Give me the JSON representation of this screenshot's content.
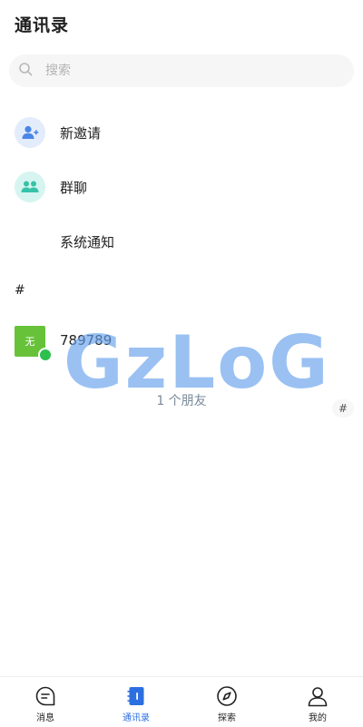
{
  "header": {
    "title": "通讯录"
  },
  "search": {
    "placeholder": "搜索"
  },
  "menu": {
    "new_invite": "新邀请",
    "group_chat": "群聊",
    "system_notice": "系统通知"
  },
  "section": {
    "letter": "#"
  },
  "contacts": [
    {
      "avatar_text": "无",
      "name": "789789",
      "online": true
    }
  ],
  "friend_count": "1 个朋友",
  "index_bar": [
    "#"
  ],
  "watermark": "GzLoG",
  "tabbar": {
    "tabs": [
      {
        "label": "消息",
        "icon": "chat-bubble-icon",
        "active": false
      },
      {
        "label": "通讯录",
        "icon": "contacts-book-icon",
        "active": true
      },
      {
        "label": "探索",
        "icon": "compass-icon",
        "active": false
      },
      {
        "label": "我的",
        "icon": "user-icon",
        "active": false
      }
    ]
  },
  "colors": {
    "accent": "#2d6fe0",
    "avatar_green": "#67c23a",
    "online_green": "#2fbf4d",
    "invite_icon_bg": "#e3ecfb",
    "group_icon_bg": "#d6f5f0"
  }
}
